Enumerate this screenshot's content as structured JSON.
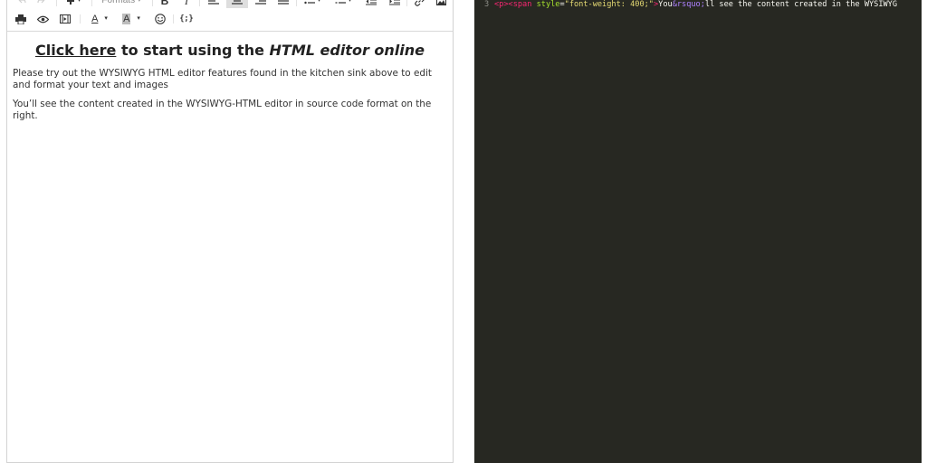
{
  "toolbar": {
    "formats_label": "Formats",
    "row1_icons": [
      "undo-icon",
      "redo-icon",
      "insert-icon",
      "formats-dropdown",
      "bold-icon",
      "italic-icon",
      "align-left-icon",
      "align-center-icon",
      "align-right-icon",
      "align-justify-icon",
      "bullet-list-icon",
      "numbered-list-icon",
      "outdent-icon",
      "indent-icon",
      "link-icon",
      "image-icon"
    ],
    "row2_icons": [
      "print-icon",
      "preview-icon",
      "media-icon",
      "text-color-icon",
      "background-color-icon",
      "emoticons-icon",
      "code-sample-icon"
    ],
    "bold_glyph": "B",
    "italic_glyph": "I",
    "text_color_glyph": "A",
    "bg_color_glyph": "A",
    "code_glyph": "{;}",
    "accent_active": "#dedede"
  },
  "content": {
    "heading_link": "Click here",
    "heading_middle": " to start using the ",
    "heading_em": "HTML editor online",
    "paragraph1": "Please try out the WYSIWYG HTML editor features found in the kitchen sink above to edit and format your text and images",
    "paragraph2": "You’ll see the content created in the WYSIWYG-HTML editor in source code format on the right."
  },
  "code": {
    "line_number": "3",
    "tokens": [
      {
        "type": "tag",
        "text": "<p><span"
      },
      {
        "type": "txt",
        "text": " "
      },
      {
        "type": "attr",
        "text": "style"
      },
      {
        "type": "txt",
        "text": "="
      },
      {
        "type": "str",
        "text": "\"font-weight: 400;\""
      },
      {
        "type": "tag",
        "text": ">"
      },
      {
        "type": "txt",
        "text": "You"
      },
      {
        "type": "ent",
        "text": "&rsquo;"
      },
      {
        "type": "txt",
        "text": "ll see the content created in the WYSIWYG"
      }
    ],
    "background": "#272822"
  }
}
